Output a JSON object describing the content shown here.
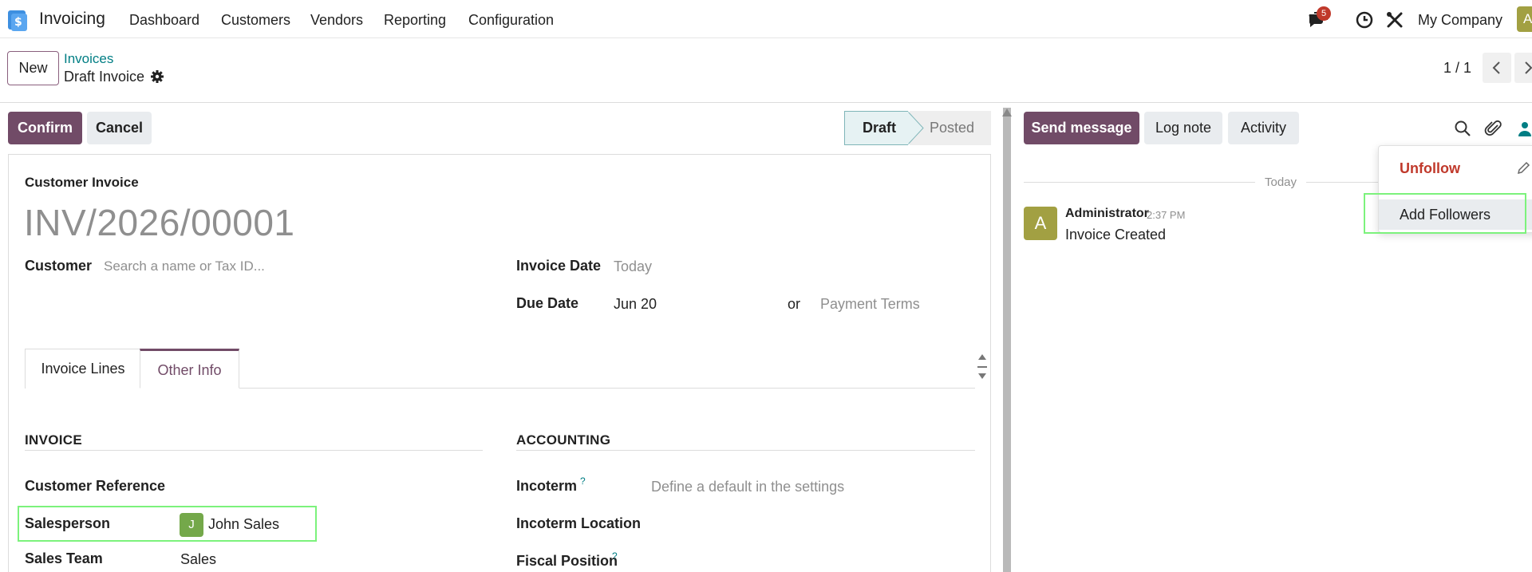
{
  "navbar": {
    "app_name": "Invoicing",
    "menu": [
      "Dashboard",
      "Customers",
      "Vendors",
      "Reporting",
      "Configuration"
    ],
    "messages_badge": "5",
    "company": "My Company",
    "user_initial": "A"
  },
  "control_panel": {
    "new_label": "New",
    "breadcrumb_parent": "Invoices",
    "breadcrumb_current": "Draft Invoice",
    "pager": "1 / 1"
  },
  "statusbar": {
    "confirm_label": "Confirm",
    "cancel_label": "Cancel",
    "states": [
      "Draft",
      "Posted"
    ],
    "current_state": "Draft"
  },
  "form": {
    "type_label": "Customer Invoice",
    "number": "INV/2026/00001",
    "customer_label": "Customer",
    "customer_placeholder": "Search a name or Tax ID...",
    "invoice_date_label": "Invoice Date",
    "invoice_date_placeholder": "Today",
    "due_date_label": "Due Date",
    "due_date_value": "Jun 20",
    "or_label": "or",
    "payment_terms_placeholder": "Payment Terms",
    "tabs": [
      "Invoice Lines",
      "Other Info"
    ],
    "active_tab": "Other Info",
    "invoice_section": {
      "title": "INVOICE",
      "customer_reference_label": "Customer Reference",
      "salesperson_label": "Salesperson",
      "salesperson_initial": "J",
      "salesperson_value": "John Sales",
      "sales_team_label": "Sales Team",
      "sales_team_value": "Sales"
    },
    "accounting_section": {
      "title": "ACCOUNTING",
      "incoterm_label": "Incoterm",
      "incoterm_placeholder": "Define a default in the settings",
      "incoterm_location_label": "Incoterm Location",
      "fiscal_position_label": "Fiscal Position",
      "help_mark": "?"
    }
  },
  "chatter": {
    "send_message_label": "Send message",
    "log_note_label": "Log note",
    "activity_label": "Activity",
    "date_separator": "Today",
    "message": {
      "author_initial": "A",
      "author": "Administrator",
      "time": "2:37 PM",
      "body": "Invoice Created"
    },
    "followers_dropdown": {
      "unfollow_label": "Unfollow",
      "add_followers_label": "Add Followers"
    }
  },
  "colors": {
    "primary": "#714b67",
    "link": "#017e84",
    "highlight": "#7cf27c",
    "danger": "#c0392b"
  }
}
